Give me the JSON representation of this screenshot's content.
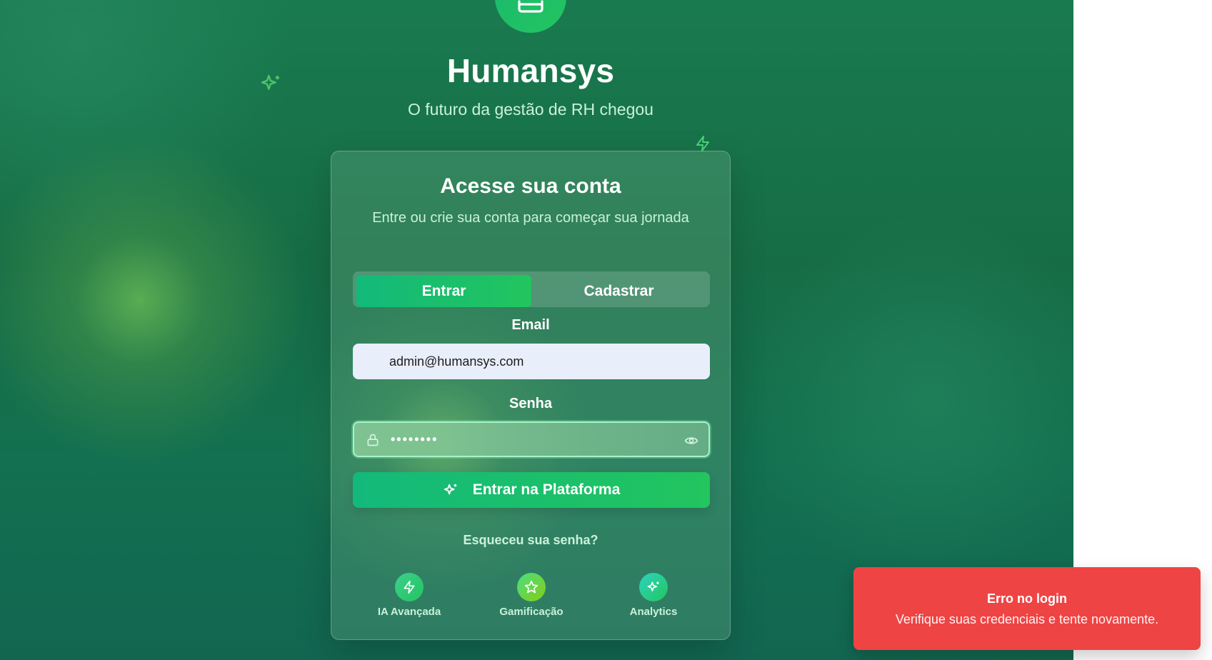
{
  "app": {
    "brand": "Humansys",
    "tagline": "O futuro da gestão de RH chegou"
  },
  "login_card": {
    "title": "Acesse sua conta",
    "subtitle": "Entre ou crie sua conta para começar sua jornada",
    "tabs": [
      {
        "label": "Entrar",
        "active": true
      },
      {
        "label": "Cadastrar",
        "active": false
      }
    ],
    "email": {
      "label": "Email",
      "value": "admin@humansys.com"
    },
    "password": {
      "label": "Senha",
      "value": "••••••••"
    },
    "submit_label": "Entrar na Plataforma",
    "forgot_label": "Esqueceu sua senha?",
    "features": [
      {
        "label": "IA Avançada",
        "icon": "bolt-icon"
      },
      {
        "label": "Gamificação",
        "icon": "star-icon"
      },
      {
        "label": "Analytics",
        "icon": "sparkles-icon"
      }
    ]
  },
  "toast": {
    "title": "Erro no login",
    "message": "Verifique suas credenciais e tente novamente.",
    "color": "#ef4444"
  },
  "colors": {
    "accent": "#22c55e",
    "accent_dark": "#13b97a",
    "background": "#166d45"
  }
}
